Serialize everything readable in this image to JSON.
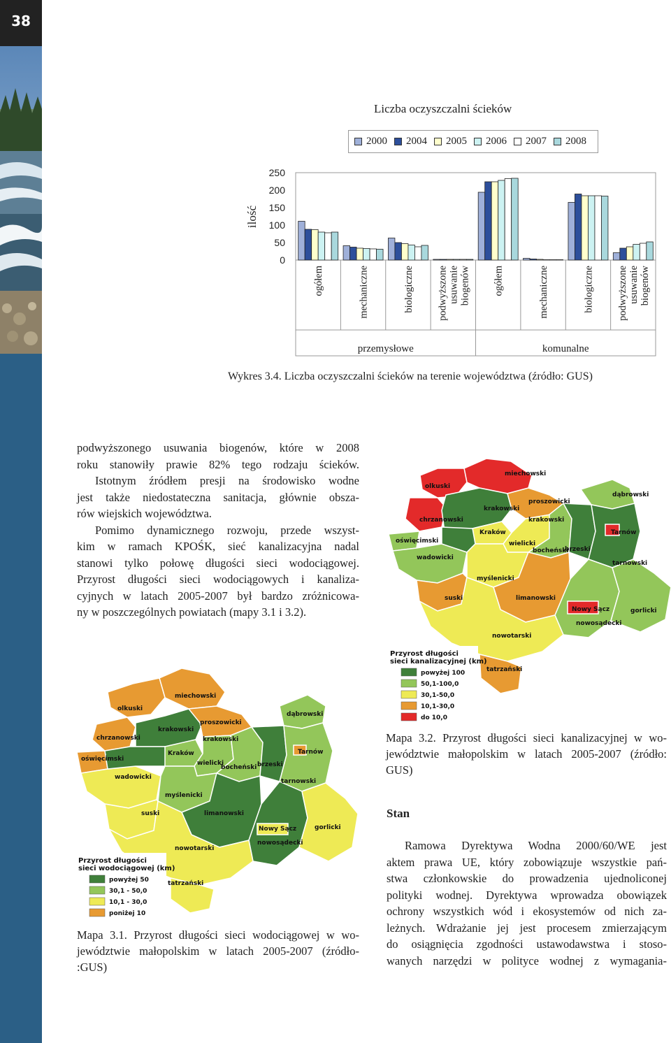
{
  "page": {
    "number": "38"
  },
  "chart_data": {
    "type": "bar",
    "title": "Liczba oczyszczalni ścieków",
    "ylabel": "ilość",
    "ylim": [
      0,
      250
    ],
    "yticks": [
      "250",
      "200",
      "150",
      "100",
      "50",
      "0"
    ],
    "categories": [
      "ogółem",
      "mechaniczne",
      "biologiczne",
      "podwyższone usuwanie biogenów",
      "ogółem",
      "mechaniczne",
      "biologiczne",
      "podwyższone usuwanie biogenów"
    ],
    "groups": [
      {
        "label": "przemysłowe",
        "start": 0,
        "end": 3
      },
      {
        "label": "komunalne",
        "start": 4,
        "end": 7
      }
    ],
    "series": [
      {
        "name": "2000",
        "color": "#9fb0d9",
        "values": [
          111,
          41,
          63,
          2,
          194,
          5,
          165,
          21
        ]
      },
      {
        "name": "2004",
        "color": "#2d4f9b",
        "values": [
          88,
          37,
          50,
          2,
          224,
          3,
          189,
          34
        ]
      },
      {
        "name": "2005",
        "color": "#ffffcc",
        "values": [
          87,
          34,
          47,
          2,
          224,
          2,
          184,
          38
        ]
      },
      {
        "name": "2006",
        "color": "#ccf2f2",
        "values": [
          80,
          33,
          43,
          2,
          228,
          1,
          184,
          45
        ]
      },
      {
        "name": "2007",
        "color": "#ffffff",
        "values": [
          78,
          32,
          38,
          2,
          233,
          1,
          184,
          48
        ]
      },
      {
        "name": "2008",
        "color": "#a9d8dd",
        "values": [
          80,
          31,
          42,
          2,
          234,
          1,
          183,
          52
        ]
      }
    ],
    "grid": false,
    "legend": "top"
  },
  "chart_caption": "Wykres 3.4. Liczba oczyszczalni ścieków na terenie województwa (źródło: GUS)",
  "paragraph1": {
    "lines": [
      "podwyższonego usuwania biogenów, które w 2008",
      "roku stanowiły prawie 82% tego rodzaju ścieków.",
      "Istotnym źródłem presji na środowisko wodne",
      "jest także niedostateczna sanitacja, głównie obsza-",
      "rów wiejskich województwa.",
      "Pomimo dynamicznego rozwoju, przede wszyst-",
      "kim w ramach KPOŚK, sieć kanalizacyjna nadal",
      "stanowi tylko połowę długości sieci wodociągowej.",
      "Przyrost długości sieci wodociągowych i kanaliza-",
      "cyjnych w latach 2005-2007 był bardzo zróżnicowa-",
      "ny w poszczególnych powiatach (mapy 3.1 i 3.2)."
    ]
  },
  "map2": {
    "legend_title_1": "Przyrost długości",
    "legend_title_2": "sieci kanalizacyjnej (km)",
    "legend": [
      {
        "label": "powyżej 100",
        "color": "#3f7f3a"
      },
      {
        "label": "50,1-100,0",
        "color": "#93c65a"
      },
      {
        "label": "30,1-50,0",
        "color": "#eeea55"
      },
      {
        "label": "10,1-30,0",
        "color": "#e79a32"
      },
      {
        "label": "do 10,0",
        "color": "#e32a2a"
      }
    ],
    "labels": [
      "miechowski",
      "olkuski",
      "krakowski",
      "proszowicki",
      "dąbrowski",
      "chrzanowski",
      "krakowski",
      "oświęcimski",
      "Kraków",
      "wielicki",
      "brzeski",
      "Tarnów",
      "bocheński",
      "wadowicki",
      "tarnowski",
      "myślenicki",
      "suski",
      "limanowski",
      "Nowy Sącz",
      "nowosądecki",
      "gorlicki",
      "nowotarski",
      "tatrzański"
    ]
  },
  "map2_caption": [
    "Mapa 3.2. Przyrost długości sieci kanalizacyjnej w wo-",
    "jewództwie małopolskim w latach 2005-2007 (źródło:",
    "GUS)"
  ],
  "map1": {
    "legend_title_1": "Przyrost długości",
    "legend_title_2": "sieci wodociągowej (km)",
    "legend": [
      {
        "label": "powyżej 50",
        "color": "#3f7f3a"
      },
      {
        "label": "30,1 - 50,0",
        "color": "#93c65a"
      },
      {
        "label": "10,1 - 30,0",
        "color": "#eeea55"
      },
      {
        "label": "poniżej 10",
        "color": "#e79a32"
      }
    ],
    "labels": [
      "miechowski",
      "olkuski",
      "proszowicki",
      "dąbrowski",
      "krakowski",
      "chrzanowski",
      "krakowski",
      "Tarnów",
      "oświęcimski",
      "Kraków",
      "wielicki",
      "brzeski",
      "bocheński",
      "wadowicki",
      "tarnowski",
      "myślenicki",
      "suski",
      "limanowski",
      "Nowy Sącz",
      "gorlicki",
      "nowosądecki",
      "nowotarski",
      "tatrzański"
    ]
  },
  "map1_caption": [
    "Mapa 3.1. Przyrost długości sieci wodociągowej w wo-",
    "jewództwie małopolskim w latach 2005-2007 (źródło-",
    ":GUS)"
  ],
  "stan_heading": "Stan",
  "paragraph2": {
    "lines": [
      "Ramowa Dyrektywa Wodna  2000/60/WE jest",
      "aktem prawa UE, który zobowiązuje wszystkie pań-",
      "stwa członkowskie do prowadzenia ujednoliconej",
      "polityki wodnej. Dyrektywa wprowadza obowiązek",
      "ochrony wszystkich wód i ekosystemów od nich za-",
      "leżnych. Wdrażanie jej jest procesem zmierzającym",
      "do osiągnięcia zgodności ustawodawstwa i stoso-",
      "wanych narzędzi w polityce wodnej z wymagania-"
    ]
  }
}
